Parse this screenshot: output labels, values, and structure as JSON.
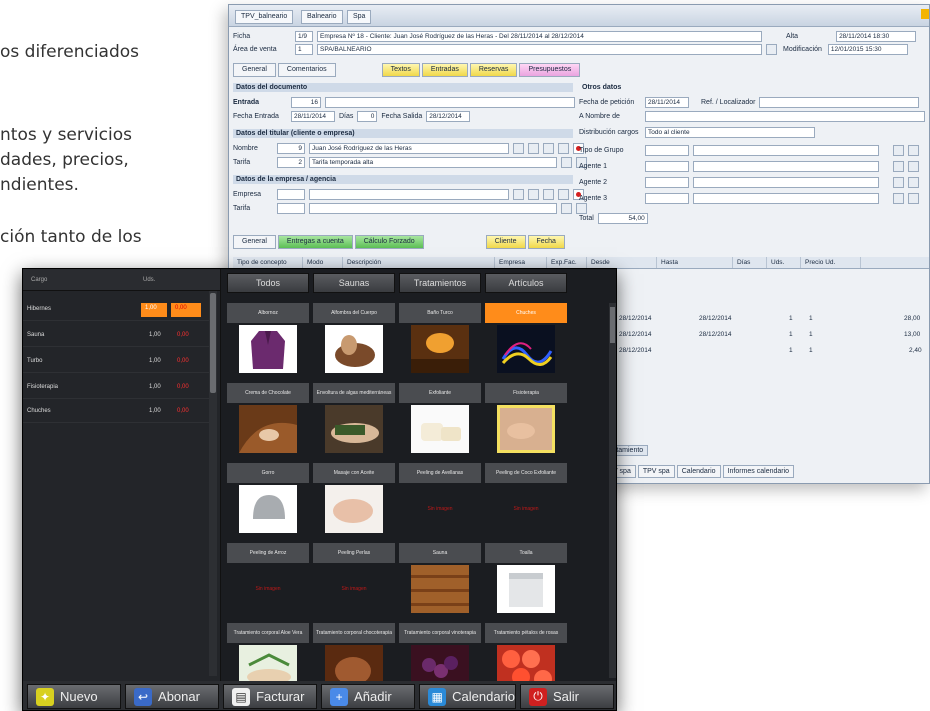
{
  "background_text": {
    "line1": "os diferenciados",
    "line2": "ntos y servicios",
    "line3": "dades,  precios,",
    "line4": "ndientes.",
    "line5": "ción tanto de los"
  },
  "back_window": {
    "tabs": [
      "TPV_balneario",
      "Balneario",
      "Spa"
    ],
    "ficha_label": "Ficha",
    "ficha_value": "Empresa Nº 18 - Cliente: Juan José Rodríguez de las Heras - Del 28/11/2014 al 28/12/2014",
    "area_label": "Área de venta",
    "area_value": "SPA/BALNEARIO",
    "alta_label": "Alta",
    "alta_value": "28/11/2014 18:30",
    "modif_label": "Modificación",
    "modif_value": "12/01/2015 15:30",
    "top_tabs": [
      "General",
      "Comentarios",
      "Textos",
      "Entradas",
      "Reservas",
      "Presupuestos"
    ],
    "sec_data": "Datos del documento",
    "entrada_label": "Entrada",
    "entrada_value": "16",
    "fecha_entrada_label": "Fecha Entrada",
    "fecha_entrada_value": "28/11/2014",
    "dias_label": "Días",
    "dias_value": "0",
    "fecha_salida_label": "Fecha Salida",
    "fecha_salida_value": "28/12/2014",
    "sec_titular": "Datos del titular (cliente o empresa)",
    "nombre_label": "Nombre",
    "nombre_value": "Juan José Rodríguez de las Heras",
    "tarifa_label": "Tarifa",
    "tarifa_value": "Tarifa temporada alta",
    "sec_empresa": "Datos de la empresa / agencia",
    "empresa_label": "Empresa",
    "tarifa2_label": "Tarifa",
    "sec_otros": "Otros datos",
    "fecha_peticion_label": "Fecha de petición",
    "fecha_peticion_value": "28/11/2014",
    "ref_label": "Ref. / Localizador",
    "nombre_de_label": "A Nombre de",
    "distrib_label": "Distribución cargos",
    "distrib_value": "Todo al cliente",
    "tipo_grupo_label": "Tipo de Grupo",
    "agente1": "Agente 1",
    "agente2": "Agente 2",
    "agente3": "Agente 3",
    "total_label": "Total",
    "total_value": "54,00",
    "lower_tabs": [
      "General",
      "Entregas a cuenta",
      "Cálculo Forzado",
      "Cliente",
      "Fecha"
    ],
    "grid_headers": [
      "Tipo de concepto",
      "Modo",
      "Descripción",
      "Empresa",
      "Exp.Fac.",
      "Desde",
      "Hasta",
      "Días",
      "Uds.",
      "Precio Ud."
    ],
    "grid_rows": [
      {
        "desde": "28/12/2014",
        "hasta": "28/12/2014",
        "dias": "1",
        "uds": "1",
        "precio": "28,00"
      },
      {
        "desde": "28/12/2014",
        "hasta": "28/12/2014",
        "dias": "1",
        "uds": "1",
        "precio": "13,00"
      },
      {
        "desde": "28/12/2014",
        "hasta": "",
        "dias": "1",
        "uds": "1",
        "precio": "2,40"
      }
    ],
    "bottom_tabs": [
      "TPV spa",
      "TPV spa",
      "Calendario",
      "Informes calendario"
    ],
    "bottom_label": "rtamiento"
  },
  "pos": {
    "left_header": {
      "col1": "Cargo",
      "col2": "Uds."
    },
    "lines": [
      {
        "name": "Hibernes",
        "qty": "1,00",
        "price": "0,00"
      },
      {
        "name": "Sauna",
        "qty": "1,00",
        "price": "0,00"
      },
      {
        "name": "Turbo",
        "qty": "1,00",
        "price": "0,00"
      },
      {
        "name": "Fisioterapia",
        "qty": "1,00",
        "price": "0,00"
      },
      {
        "name": "Chuches",
        "qty": "1,00",
        "price": "0,00"
      }
    ],
    "categories": [
      "Todos",
      "Saunas",
      "Tratamientos",
      "Artículos"
    ],
    "products": [
      {
        "name": "Albornoz"
      },
      {
        "name": "Alfombra del Cuerpo"
      },
      {
        "name": "Baño Turco"
      },
      {
        "name": "Chuches"
      },
      {
        "name": "Crema de Chocolate"
      },
      {
        "name": "Envoltura de algas mediterráneas"
      },
      {
        "name": "Exfoliante"
      },
      {
        "name": "Fisioterapia"
      },
      {
        "name": "Gorro"
      },
      {
        "name": "Masaje con Aceite"
      },
      {
        "name": "Peeling de Avellanas",
        "noimg": "Sin imagen"
      },
      {
        "name": "Peeling de Coco Exfoliante",
        "noimg": "Sin imagen"
      },
      {
        "name": "Peeling de Arroz",
        "noimg": "Sin imagen"
      },
      {
        "name": "Peeling Perlas",
        "noimg": "Sin imagen"
      },
      {
        "name": "Sauna"
      },
      {
        "name": "Toalla"
      },
      {
        "name": "Tratamiento corporal Aloe Vera"
      },
      {
        "name": "Tratamiento corporal chocoterapia"
      },
      {
        "name": "Tratamiento corporal vinoterapia"
      },
      {
        "name": "Tratamiento pétalos de rosas"
      }
    ],
    "buttons": [
      {
        "label": "Nuevo",
        "icon": "new-icon"
      },
      {
        "label": "Abonar",
        "icon": "credit-icon"
      },
      {
        "label": "Facturar",
        "icon": "invoice-icon"
      },
      {
        "label": "Añadir",
        "icon": "add-icon"
      },
      {
        "label": "Calendario",
        "icon": "calendar-icon"
      },
      {
        "label": "Salir",
        "icon": "exit-icon"
      }
    ],
    "accent": "#ff8c1a"
  }
}
